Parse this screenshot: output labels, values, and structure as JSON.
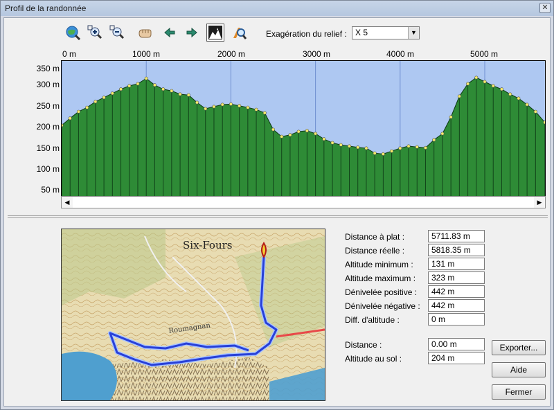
{
  "window": {
    "title": "Profil de la randonnée",
    "close_icon": "close-icon"
  },
  "toolbar": {
    "icons": [
      "globe-zoom-icon",
      "zoom-in-icon",
      "zoom-out-icon",
      "pan-hand-icon",
      "arrow-left-icon",
      "arrow-right-icon",
      "terrain-profile-icon",
      "route-search-icon"
    ],
    "relief_label": "Exagération du relief :",
    "relief_value": "X 5"
  },
  "chart_data": {
    "type": "area",
    "x_ticks": [
      "0 m",
      "1000 m",
      "2000 m",
      "3000 m",
      "4000 m",
      "5000 m"
    ],
    "y_ticks": [
      "350 m",
      "300 m",
      "250 m",
      "200 m",
      "150 m",
      "100 m",
      "50 m"
    ],
    "xlim": [
      0,
      5711.83
    ],
    "ylim": [
      30,
      360
    ],
    "x": [
      0,
      100,
      200,
      300,
      400,
      500,
      600,
      700,
      800,
      900,
      1000,
      1100,
      1200,
      1300,
      1400,
      1500,
      1600,
      1700,
      1800,
      1900,
      2000,
      2100,
      2200,
      2300,
      2400,
      2500,
      2600,
      2700,
      2800,
      2900,
      3000,
      3100,
      3200,
      3300,
      3400,
      3500,
      3600,
      3700,
      3800,
      3900,
      4000,
      4100,
      4200,
      4300,
      4400,
      4500,
      4600,
      4700,
      4800,
      4900,
      5000,
      5100,
      5200,
      5300,
      5400,
      5500,
      5600,
      5711
    ],
    "y": [
      205,
      222,
      238,
      248,
      262,
      272,
      282,
      292,
      300,
      305,
      318,
      302,
      292,
      288,
      280,
      278,
      260,
      245,
      250,
      255,
      256,
      252,
      248,
      243,
      235,
      195,
      178,
      182,
      190,
      192,
      185,
      172,
      163,
      158,
      155,
      152,
      150,
      138,
      136,
      143,
      150,
      155,
      153,
      151,
      170,
      185,
      225,
      275,
      305,
      320,
      310,
      300,
      292,
      280,
      270,
      255,
      238,
      212
    ]
  },
  "stats": [
    {
      "label": "Distance à plat :",
      "value": "5711.83 m"
    },
    {
      "label": "Distance réelle :",
      "value": "5818.35 m"
    },
    {
      "label": "Altitude minimum :",
      "value": "131 m"
    },
    {
      "label": "Altitude maximum :",
      "value": "323 m"
    },
    {
      "label": "Dénivelée positive :",
      "value": "442 m"
    },
    {
      "label": "Dénivelée négative :",
      "value": "442 m"
    },
    {
      "label": "Diff. d'altitude :",
      "value": "0 m"
    }
  ],
  "cursor": [
    {
      "label": "Distance :",
      "value": "0.00 m"
    },
    {
      "label": "Altitude au sol :",
      "value": "204 m"
    }
  ],
  "map": {
    "place_label": "Six-Fours",
    "road_label": "Roumagnan",
    "colors": {
      "route": "#2840d8",
      "route_outline": "#a8c4ff"
    }
  },
  "buttons": {
    "export": "Exporter...",
    "help": "Aide",
    "close": "Fermer"
  },
  "colors": {
    "terrain_fill": "#2e8b36",
    "profile_marker": "#f6ec6a",
    "plot_bg": "#aec8f2"
  }
}
